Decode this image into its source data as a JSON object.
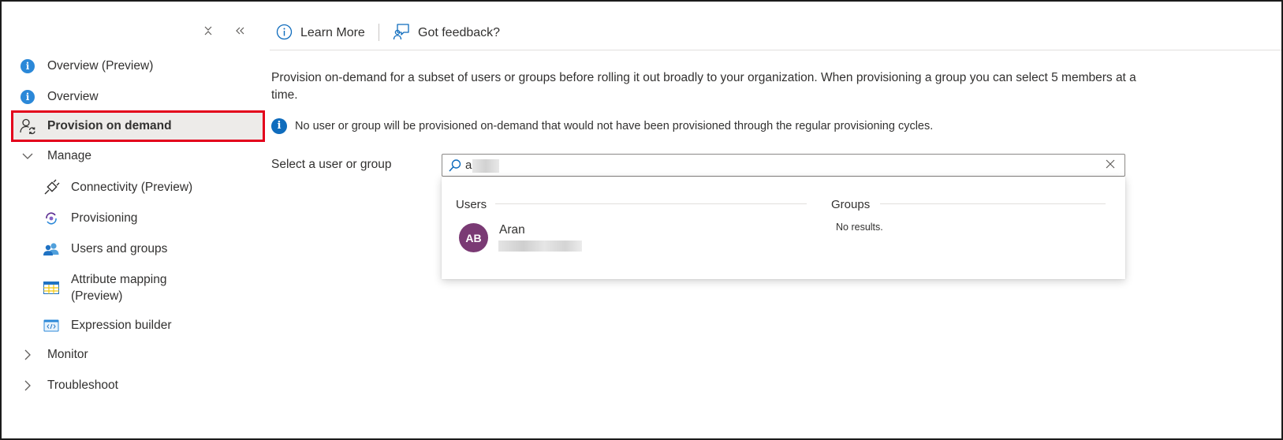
{
  "sidebar": {
    "items": [
      {
        "label": "Overview (Preview)"
      },
      {
        "label": "Overview"
      },
      {
        "label": "Provision on demand"
      },
      {
        "label": "Manage"
      },
      {
        "label": "Connectivity (Preview)"
      },
      {
        "label": "Provisioning"
      },
      {
        "label": "Users and groups"
      },
      {
        "label": "Attribute mapping",
        "label2": "(Preview)"
      },
      {
        "label": "Expression builder"
      },
      {
        "label": "Monitor"
      },
      {
        "label": "Troubleshoot"
      }
    ]
  },
  "toolbar": {
    "learn_more": "Learn More",
    "feedback": "Got feedback?"
  },
  "main": {
    "description": "Provision on-demand for a subset of users or groups before rolling it out broadly to your organization. When provisioning a group you can select 5 members at a time.",
    "notice": "No user or group will be provisioned on-demand that would not have been provisioned through the regular provisioning cycles.",
    "field_label": "Select a user or group",
    "search_value": "a"
  },
  "results": {
    "users_heading": "Users",
    "groups_heading": "Groups",
    "user": {
      "initials": "AB",
      "name": "Aran"
    },
    "groups_empty": "No results."
  },
  "colors": {
    "accent": "#0f6cbd",
    "selected_outline": "#e3001b",
    "avatar": "#7a3a74"
  }
}
